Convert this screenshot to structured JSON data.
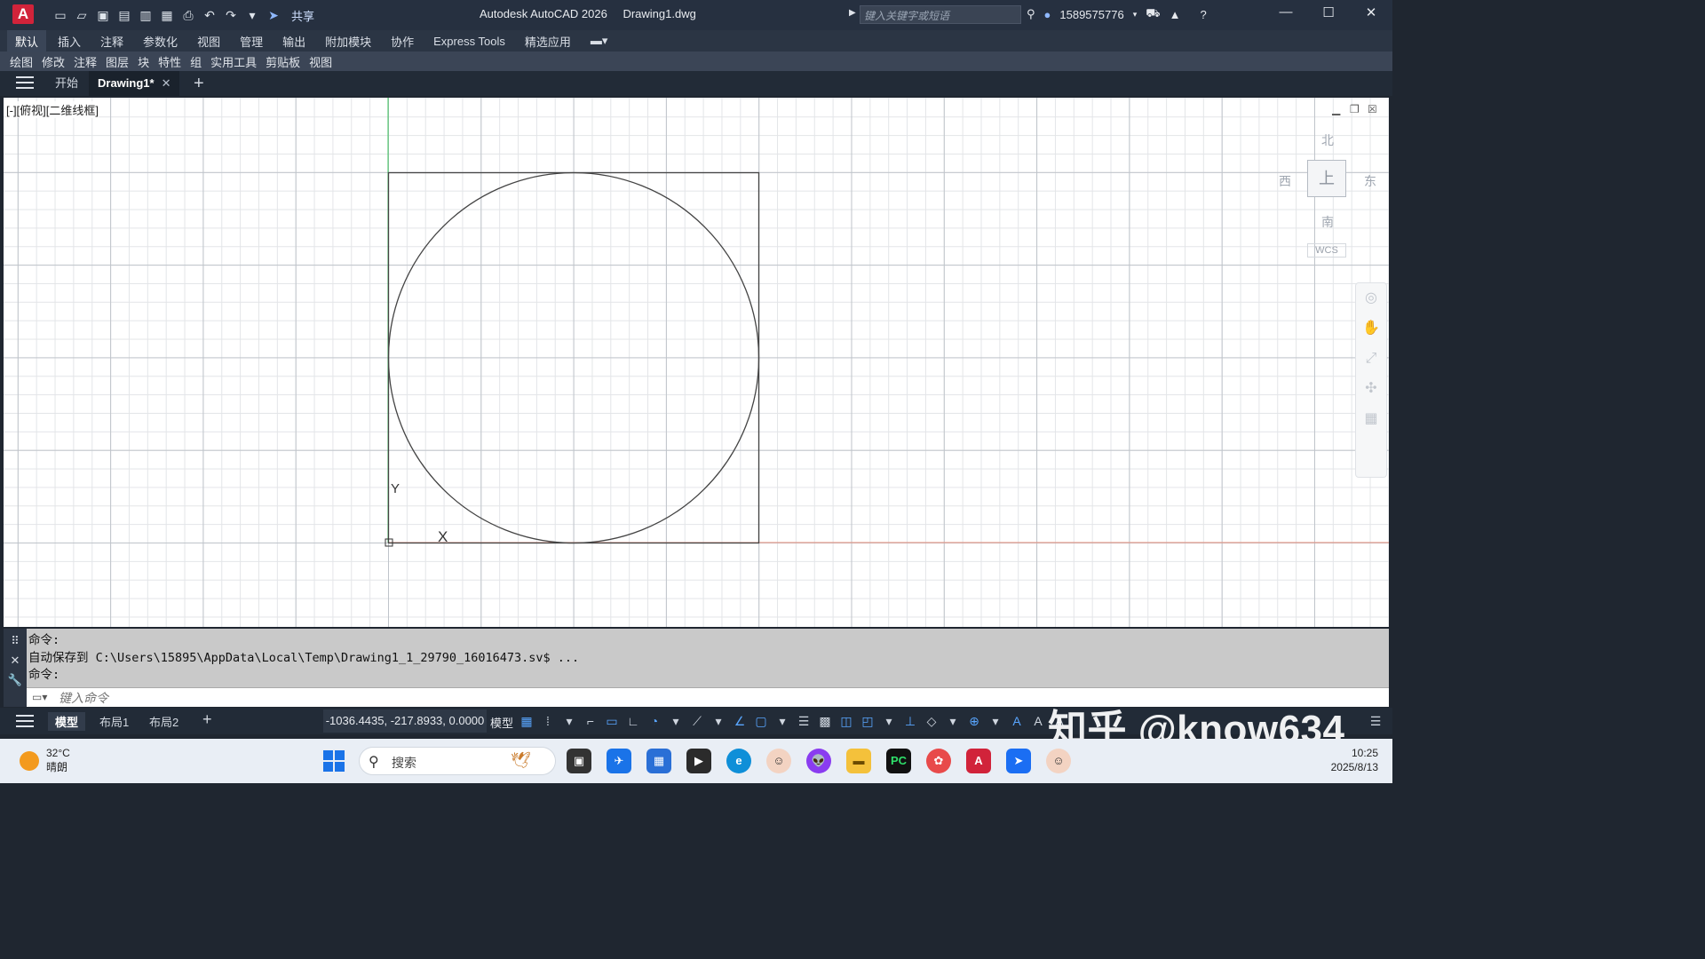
{
  "titlebar": {
    "logo": "A",
    "share_label": "共享",
    "app_name": "Autodesk AutoCAD 2026",
    "file_name": "Drawing1.dwg",
    "search_placeholder": "键入关键字或短语",
    "user_id": "1589575776"
  },
  "ribbon_tabs": [
    "默认",
    "插入",
    "注释",
    "参数化",
    "视图",
    "管理",
    "输出",
    "附加模块",
    "协作",
    "Express Tools",
    "精选应用"
  ],
  "ribbon_panels": [
    "绘图",
    "修改",
    "注释",
    "图层",
    "块",
    "特性",
    "组",
    "实用工具",
    "剪贴板",
    "视图"
  ],
  "doc_tabs": {
    "start_label": "开始",
    "drawing_label": "Drawing1*"
  },
  "viewport": {
    "label": "[-][俯视][二维线框]",
    "ucs_y": "Y",
    "ucs_x": "X"
  },
  "viewcube": {
    "north": "北",
    "south": "南",
    "east": "东",
    "west": "西",
    "top_face": "上",
    "wcs": "WCS"
  },
  "command": {
    "history": [
      "命令:",
      "自动保存到 C:\\Users\\15895\\AppData\\Local\\Temp\\Drawing1_1_29790_16016473.sv$ ...",
      "命令:"
    ],
    "input_placeholder": "键入命令"
  },
  "statusbar": {
    "tab_model": "模型",
    "tab_layout1": "布局1",
    "tab_layout2": "布局2",
    "coordinates": "-1036.4435, -217.8933, 0.0000",
    "space": "模型",
    "watermark": "知乎 @know634"
  },
  "taskbar": {
    "temperature": "32°C",
    "weather": "晴朗",
    "search_label": "搜索",
    "time": "10:25",
    "date": "2025/8/13"
  },
  "colors": {
    "accent_red": "#d1233a",
    "canvas_bg": "#ffffff",
    "ui_dark": "#222b37"
  }
}
